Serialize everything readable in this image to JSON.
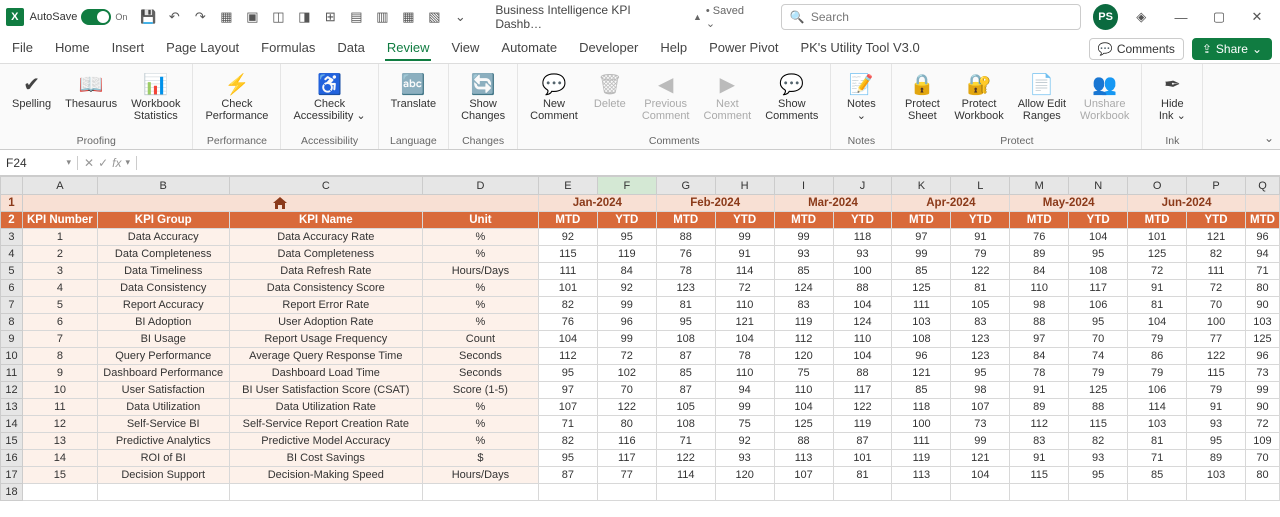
{
  "titlebar": {
    "autosave_label": "AutoSave",
    "autosave_state": "On",
    "doc_title": "Business Intelligence KPI Dashb…",
    "saved_icon": "▲",
    "saved_text": "• Saved ⌄",
    "search_placeholder": "Search",
    "avatar_initials": "PS"
  },
  "tabs": {
    "items": [
      "File",
      "Home",
      "Insert",
      "Page Layout",
      "Formulas",
      "Data",
      "Review",
      "View",
      "Automate",
      "Developer",
      "Help",
      "Power Pivot",
      "PK's Utility Tool V3.0"
    ],
    "active_index": 6,
    "comments_label": "Comments",
    "share_label": "Share"
  },
  "ribbon": {
    "groups": [
      {
        "name": "Proofing",
        "buttons": [
          {
            "l": "Spelling",
            "i": "✔"
          },
          {
            "l": "Thesaurus",
            "i": "📖"
          },
          {
            "l": "Workbook\nStatistics",
            "i": "📊"
          }
        ]
      },
      {
        "name": "Performance",
        "buttons": [
          {
            "l": "Check\nPerformance",
            "i": "⚡"
          }
        ]
      },
      {
        "name": "Accessibility",
        "buttons": [
          {
            "l": "Check\nAccessibility ⌄",
            "i": "♿"
          }
        ]
      },
      {
        "name": "Language",
        "buttons": [
          {
            "l": "Translate",
            "i": "🔤"
          }
        ]
      },
      {
        "name": "Changes",
        "buttons": [
          {
            "l": "Show\nChanges",
            "i": "🔄"
          }
        ]
      },
      {
        "name": "Comments",
        "buttons": [
          {
            "l": "New\nComment",
            "i": "💬"
          },
          {
            "l": "Delete",
            "i": "🗑",
            "d": true
          },
          {
            "l": "Previous\nComment",
            "i": "◀",
            "d": true
          },
          {
            "l": "Next\nComment",
            "i": "▶",
            "d": true
          },
          {
            "l": "Show\nComments",
            "i": "💬"
          }
        ]
      },
      {
        "name": "Notes",
        "buttons": [
          {
            "l": "Notes\n⌄",
            "i": "📝"
          }
        ]
      },
      {
        "name": "Protect",
        "buttons": [
          {
            "l": "Protect\nSheet",
            "i": "🔒"
          },
          {
            "l": "Protect\nWorkbook",
            "i": "🔐"
          },
          {
            "l": "Allow Edit\nRanges",
            "i": "📄"
          },
          {
            "l": "Unshare\nWorkbook",
            "i": "👥",
            "d": true
          }
        ]
      },
      {
        "name": "Ink",
        "buttons": [
          {
            "l": "Hide\nInk ⌄",
            "i": "✒"
          }
        ]
      }
    ]
  },
  "formulabar": {
    "namebox": "F24"
  },
  "sheet": {
    "col_letters": [
      "A",
      "B",
      "C",
      "D",
      "E",
      "F",
      "G",
      "H",
      "I",
      "J",
      "K",
      "L",
      "M",
      "N",
      "O",
      "P",
      "Q"
    ],
    "selected_col": "F",
    "months": [
      "Jan-2024",
      "Feb-2024",
      "Mar-2024",
      "Apr-2024",
      "May-2024",
      "Jun-2024"
    ],
    "sub_headers": [
      "KPI Number",
      "KPI Group",
      "KPI Name",
      "Unit"
    ],
    "mtd": "MTD",
    "ytd": "YTD",
    "rows": [
      {
        "n": 1,
        "g": "Data Accuracy",
        "k": "Data Accuracy Rate",
        "u": "%",
        "v": [
          92,
          95,
          88,
          99,
          99,
          118,
          97,
          91,
          76,
          104,
          101,
          121,
          96
        ]
      },
      {
        "n": 2,
        "g": "Data Completeness",
        "k": "Data Completeness",
        "u": "%",
        "v": [
          115,
          119,
          76,
          91,
          93,
          93,
          99,
          79,
          89,
          95,
          125,
          82,
          94
        ]
      },
      {
        "n": 3,
        "g": "Data Timeliness",
        "k": "Data Refresh Rate",
        "u": "Hours/Days",
        "v": [
          111,
          84,
          78,
          114,
          85,
          100,
          85,
          122,
          84,
          108,
          72,
          111,
          71
        ]
      },
      {
        "n": 4,
        "g": "Data Consistency",
        "k": "Data Consistency Score",
        "u": "%",
        "v": [
          101,
          92,
          123,
          72,
          124,
          88,
          125,
          81,
          110,
          117,
          91,
          72,
          80
        ]
      },
      {
        "n": 5,
        "g": "Report Accuracy",
        "k": "Report Error Rate",
        "u": "%",
        "v": [
          82,
          99,
          81,
          110,
          83,
          104,
          111,
          105,
          98,
          106,
          81,
          70,
          90
        ]
      },
      {
        "n": 6,
        "g": "BI Adoption",
        "k": "User Adoption Rate",
        "u": "%",
        "v": [
          76,
          96,
          95,
          121,
          119,
          124,
          103,
          83,
          88,
          95,
          104,
          100,
          103
        ]
      },
      {
        "n": 7,
        "g": "BI Usage",
        "k": "Report Usage Frequency",
        "u": "Count",
        "v": [
          104,
          99,
          108,
          104,
          112,
          110,
          108,
          123,
          97,
          70,
          79,
          77,
          125
        ]
      },
      {
        "n": 8,
        "g": "Query Performance",
        "k": "Average Query Response Time",
        "u": "Seconds",
        "v": [
          112,
          72,
          87,
          78,
          120,
          104,
          96,
          123,
          84,
          74,
          86,
          122,
          96
        ]
      },
      {
        "n": 9,
        "g": "Dashboard Performance",
        "k": "Dashboard Load Time",
        "u": "Seconds",
        "v": [
          95,
          102,
          85,
          110,
          75,
          88,
          121,
          95,
          78,
          79,
          79,
          115,
          73
        ]
      },
      {
        "n": 10,
        "g": "User Satisfaction",
        "k": "BI User Satisfaction Score (CSAT)",
        "u": "Score (1-5)",
        "v": [
          97,
          70,
          87,
          94,
          110,
          117,
          85,
          98,
          91,
          125,
          106,
          79,
          99
        ]
      },
      {
        "n": 11,
        "g": "Data Utilization",
        "k": "Data Utilization Rate",
        "u": "%",
        "v": [
          107,
          122,
          105,
          99,
          104,
          122,
          118,
          107,
          89,
          88,
          114,
          91,
          90
        ]
      },
      {
        "n": 12,
        "g": "Self-Service BI",
        "k": "Self-Service Report Creation Rate",
        "u": "%",
        "v": [
          71,
          80,
          108,
          75,
          125,
          119,
          100,
          73,
          112,
          115,
          103,
          93,
          72
        ]
      },
      {
        "n": 13,
        "g": "Predictive Analytics",
        "k": "Predictive Model Accuracy",
        "u": "%",
        "v": [
          82,
          116,
          71,
          92,
          88,
          87,
          111,
          99,
          83,
          82,
          81,
          95,
          109
        ]
      },
      {
        "n": 14,
        "g": "ROI of BI",
        "k": "BI Cost Savings",
        "u": "$",
        "v": [
          95,
          117,
          122,
          93,
          113,
          101,
          119,
          121,
          91,
          93,
          71,
          89,
          70
        ]
      },
      {
        "n": 15,
        "g": "Decision Support",
        "k": "Decision-Making Speed",
        "u": "Hours/Days",
        "v": [
          87,
          77,
          114,
          120,
          107,
          81,
          113,
          104,
          115,
          95,
          85,
          103,
          80
        ]
      }
    ]
  }
}
